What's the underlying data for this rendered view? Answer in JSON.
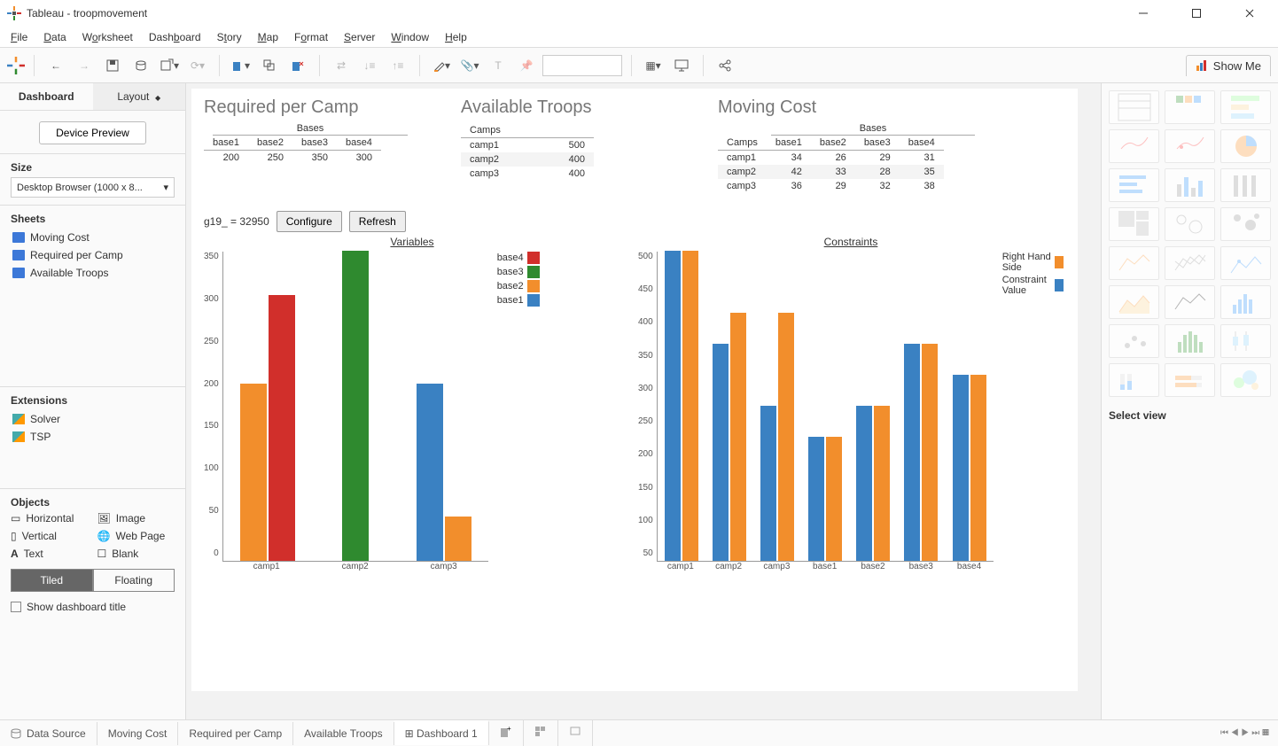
{
  "window": {
    "title": "Tableau - troopmovement"
  },
  "menu": [
    "File",
    "Data",
    "Worksheet",
    "Dashboard",
    "Story",
    "Map",
    "Format",
    "Server",
    "Window",
    "Help"
  ],
  "showme": "Show Me",
  "left": {
    "tabs": [
      "Dashboard",
      "Layout"
    ],
    "device_preview": "Device Preview",
    "size_hdr": "Size",
    "size_val": "Desktop Browser (1000 x 8...",
    "sheets_hdr": "Sheets",
    "sheets": [
      "Moving Cost",
      "Required per Camp",
      "Available Troops"
    ],
    "ext_hdr": "Extensions",
    "extensions": [
      "Solver",
      "TSP"
    ],
    "objects_hdr": "Objects",
    "objects": [
      "Horizontal",
      "Image",
      "Vertical",
      "Web Page",
      "Text",
      "Blank"
    ],
    "tiled": "Tiled",
    "floating": "Floating",
    "show_title": "Show dashboard title"
  },
  "dash": {
    "required_title": "Required per Camp",
    "available_title": "Available Troops",
    "moving_title": "Moving Cost",
    "bases_label": "Bases",
    "camps_label": "Camps",
    "g19": "g19_ = 32950",
    "configure": "Configure",
    "refresh": "Refresh",
    "variables_title": "Variables",
    "constraints_title": "Constraints"
  },
  "right": {
    "select_view": "Select view"
  },
  "bottom": {
    "datasource": "Data Source",
    "tabs": [
      "Moving Cost",
      "Required per Camp",
      "Available Troops",
      "Dashboard 1"
    ]
  },
  "chart_data": [
    {
      "type": "table",
      "title": "Required per Camp",
      "columns": [
        "base1",
        "base2",
        "base3",
        "base4"
      ],
      "rows": [
        [
          200,
          250,
          350,
          300
        ]
      ]
    },
    {
      "type": "table",
      "title": "Available Troops",
      "columns": [
        "Camps",
        ""
      ],
      "rows": [
        [
          "camp1",
          500
        ],
        [
          "camp2",
          400
        ],
        [
          "camp3",
          400
        ]
      ]
    },
    {
      "type": "table",
      "title": "Moving Cost",
      "row_header": "Camps",
      "col_header": "Bases",
      "columns": [
        "",
        "base1",
        "base2",
        "base3",
        "base4"
      ],
      "rows": [
        [
          "camp1",
          34,
          26,
          29,
          31
        ],
        [
          "camp2",
          42,
          33,
          28,
          35
        ],
        [
          "camp3",
          36,
          29,
          32,
          38
        ]
      ]
    },
    {
      "type": "bar",
      "title": "Variables",
      "categories": [
        "camp1",
        "camp2",
        "camp3"
      ],
      "series": [
        {
          "name": "base4",
          "color": "#d12f2b",
          "values": [
            300,
            0,
            0
          ]
        },
        {
          "name": "base3",
          "color": "#2f8a2f",
          "values": [
            0,
            350,
            0
          ]
        },
        {
          "name": "base2",
          "color": "#f28e2c",
          "values": [
            200,
            0,
            50
          ]
        },
        {
          "name": "base1",
          "color": "#3a81c2",
          "values": [
            0,
            0,
            200
          ]
        }
      ],
      "ylim": [
        0,
        350
      ],
      "yticks": [
        0,
        50,
        100,
        150,
        200,
        250,
        300,
        350
      ]
    },
    {
      "type": "bar",
      "title": "Constraints",
      "categories": [
        "camp1",
        "camp2",
        "camp3",
        "base1",
        "base2",
        "base3",
        "base4"
      ],
      "series": [
        {
          "name": "Right Hand Side",
          "color": "#f28e2c",
          "values": [
            500,
            400,
            400,
            200,
            250,
            350,
            300
          ]
        },
        {
          "name": "Constraint Value",
          "color": "#3a81c2",
          "values": [
            500,
            350,
            250,
            200,
            250,
            350,
            300
          ]
        }
      ],
      "ylim": [
        0,
        500
      ],
      "yticks": [
        50,
        100,
        150,
        200,
        250,
        300,
        350,
        400,
        450,
        500
      ]
    }
  ]
}
